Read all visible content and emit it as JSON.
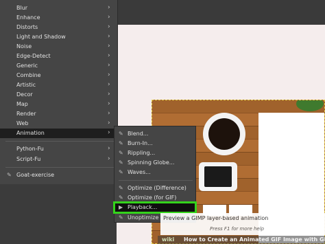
{
  "filters_menu": {
    "items": [
      {
        "label": "Blur",
        "has_submenu": true
      },
      {
        "label": "Enhance",
        "has_submenu": true
      },
      {
        "label": "Distorts",
        "has_submenu": true
      },
      {
        "label": "Light and Shadow",
        "has_submenu": true
      },
      {
        "label": "Noise",
        "has_submenu": true
      },
      {
        "label": "Edge-Detect",
        "has_submenu": true
      },
      {
        "label": "Generic",
        "has_submenu": true
      },
      {
        "label": "Combine",
        "has_submenu": true
      },
      {
        "label": "Artistic",
        "has_submenu": true
      },
      {
        "label": "Decor",
        "has_submenu": true
      },
      {
        "label": "Map",
        "has_submenu": true
      },
      {
        "label": "Render",
        "has_submenu": true
      },
      {
        "label": "Web",
        "has_submenu": true
      },
      {
        "label": "Animation",
        "has_submenu": true,
        "active": true
      },
      {
        "label": "Python-Fu",
        "has_submenu": true
      },
      {
        "label": "Script-Fu",
        "has_submenu": true
      },
      {
        "label": "Goat-exercise",
        "icon": "script-icon"
      }
    ],
    "arrow_glyph": "›"
  },
  "animation_submenu": {
    "items": [
      {
        "label": "Blend...",
        "icon": "script-icon"
      },
      {
        "label": "Burn-In...",
        "icon": "script-icon"
      },
      {
        "label": "Rippling...",
        "icon": "script-icon"
      },
      {
        "label": "Spinning Globe...",
        "icon": "script-icon"
      },
      {
        "label": "Waves...",
        "icon": "script-icon"
      },
      {
        "label": "Optimize (Difference)",
        "icon": "script-icon"
      },
      {
        "label": "Optimize (for GIF)",
        "icon": "script-icon"
      },
      {
        "label": "Playback...",
        "icon": "play-icon",
        "highlighted": true
      },
      {
        "label": "Unoptimize",
        "icon": "script-icon"
      }
    ]
  },
  "tooltip": {
    "text": "Preview a GIMP layer-based animation",
    "help": "Press F1 for more help"
  },
  "caption": {
    "brand": "wiki",
    "title": "How to Create an Animated GIF Image with GIMP"
  },
  "colors": {
    "highlight_outline": "#34d31c",
    "menu_bg": "#454545"
  }
}
